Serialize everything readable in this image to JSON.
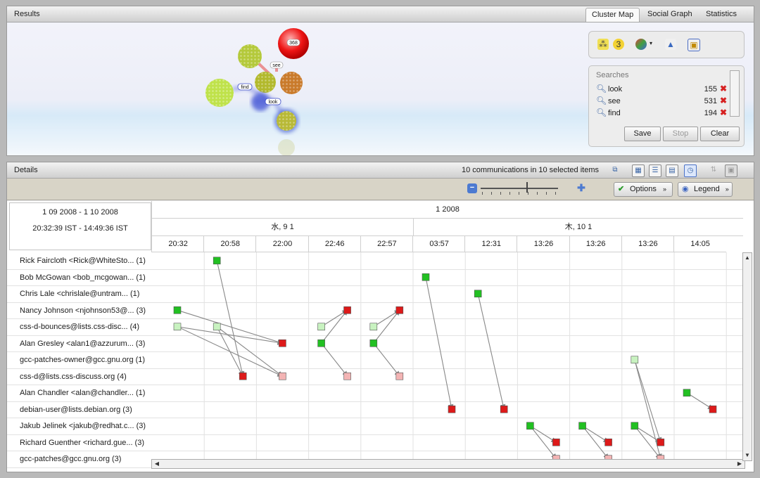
{
  "results": {
    "title": "Results",
    "tabs": [
      "Cluster Map",
      "Social Graph",
      "Statistics"
    ],
    "active_tab": "Cluster Map",
    "cluster_labels": [
      "368",
      "see",
      "find",
      "look"
    ],
    "searches": {
      "title": "Searches",
      "items": [
        {
          "term": "look",
          "count": "155"
        },
        {
          "term": "see",
          "count": "531"
        },
        {
          "term": "find",
          "count": "194"
        }
      ]
    },
    "buttons": {
      "save": "Save",
      "stop": "Stop",
      "clear": "Clear"
    }
  },
  "details": {
    "title": "Details",
    "summary": "10 communications in 10 selected items",
    "options_label": "Options",
    "legend_label": "Legend",
    "date_range": "1 09 2008 - 1 10 2008",
    "time_range": "20:32:39 IST - 14:49:36 IST",
    "month_label": "1 2008",
    "days": [
      "水, 9 1",
      "木, 10 1"
    ],
    "times": [
      "20:32",
      "20:58",
      "22:00",
      "22:46",
      "22:57",
      "03:57",
      "12:31",
      "13:26",
      "13:26",
      "13:26",
      "14:05"
    ],
    "rows": [
      "Rick Faircloth <Rick@WhiteSto... (1)",
      "Bob McGowan <bob_mcgowan... (1)",
      "Chris Lale <chrislale@untram... (1)",
      "Nancy Johnson <njohnson53@... (3)",
      "css-d-bounces@lists.css-disc... (4)",
      "Alan Gresley <alan1@azzurum... (3)",
      "gcc-patches-owner@gcc.gnu.org (1)",
      "css-d@lists.css-discuss.org (4)",
      "Alan Chandler <alan@chandler... (1)",
      "debian-user@lists.debian.org (3)",
      "Jakub Jelinek <jakub@redhat.c... (3)",
      "Richard Guenther <richard.gue... (3)",
      "gcc-patches@gcc.gnu.org (3)"
    ],
    "colors": {
      "sender": "#22c022",
      "sender_light": "#c8f2c0",
      "receiver": "#dd1a1a",
      "receiver_light": "#f3b4b4"
    }
  }
}
